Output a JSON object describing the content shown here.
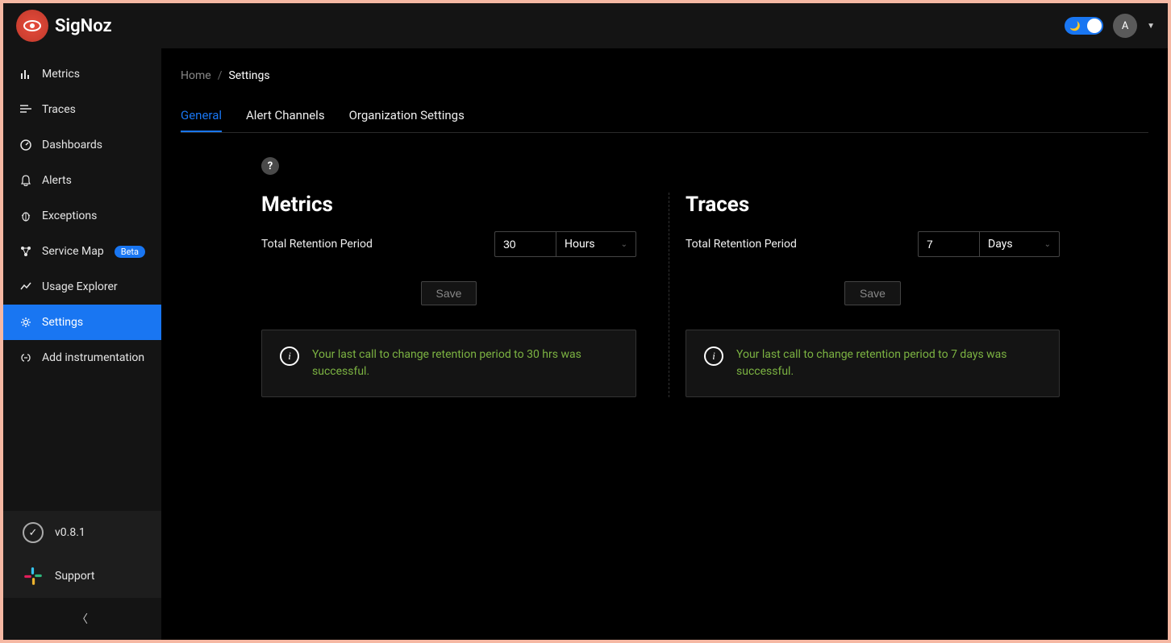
{
  "brand": {
    "name": "SigNoz"
  },
  "header": {
    "avatar_initial": "A"
  },
  "sidebar": {
    "items": [
      {
        "label": "Metrics"
      },
      {
        "label": "Traces"
      },
      {
        "label": "Dashboards"
      },
      {
        "label": "Alerts"
      },
      {
        "label": "Exceptions"
      },
      {
        "label": "Service Map",
        "badge": "Beta"
      },
      {
        "label": "Usage Explorer"
      },
      {
        "label": "Settings"
      },
      {
        "label": "Add instrumentation"
      }
    ],
    "version": "v0.8.1",
    "support": "Support"
  },
  "breadcrumb": {
    "home": "Home",
    "current": "Settings"
  },
  "tabs": [
    {
      "label": "General"
    },
    {
      "label": "Alert Channels"
    },
    {
      "label": "Organization Settings"
    }
  ],
  "panels": {
    "metrics": {
      "title": "Metrics",
      "field_label": "Total Retention Period",
      "value": "30",
      "unit": "Hours",
      "save_label": "Save",
      "status": "Your last call to change retention period to 30 hrs was successful."
    },
    "traces": {
      "title": "Traces",
      "field_label": "Total Retention Period",
      "value": "7",
      "unit": "Days",
      "save_label": "Save",
      "status": "Your last call to change retention period to 7 days was successful."
    }
  }
}
